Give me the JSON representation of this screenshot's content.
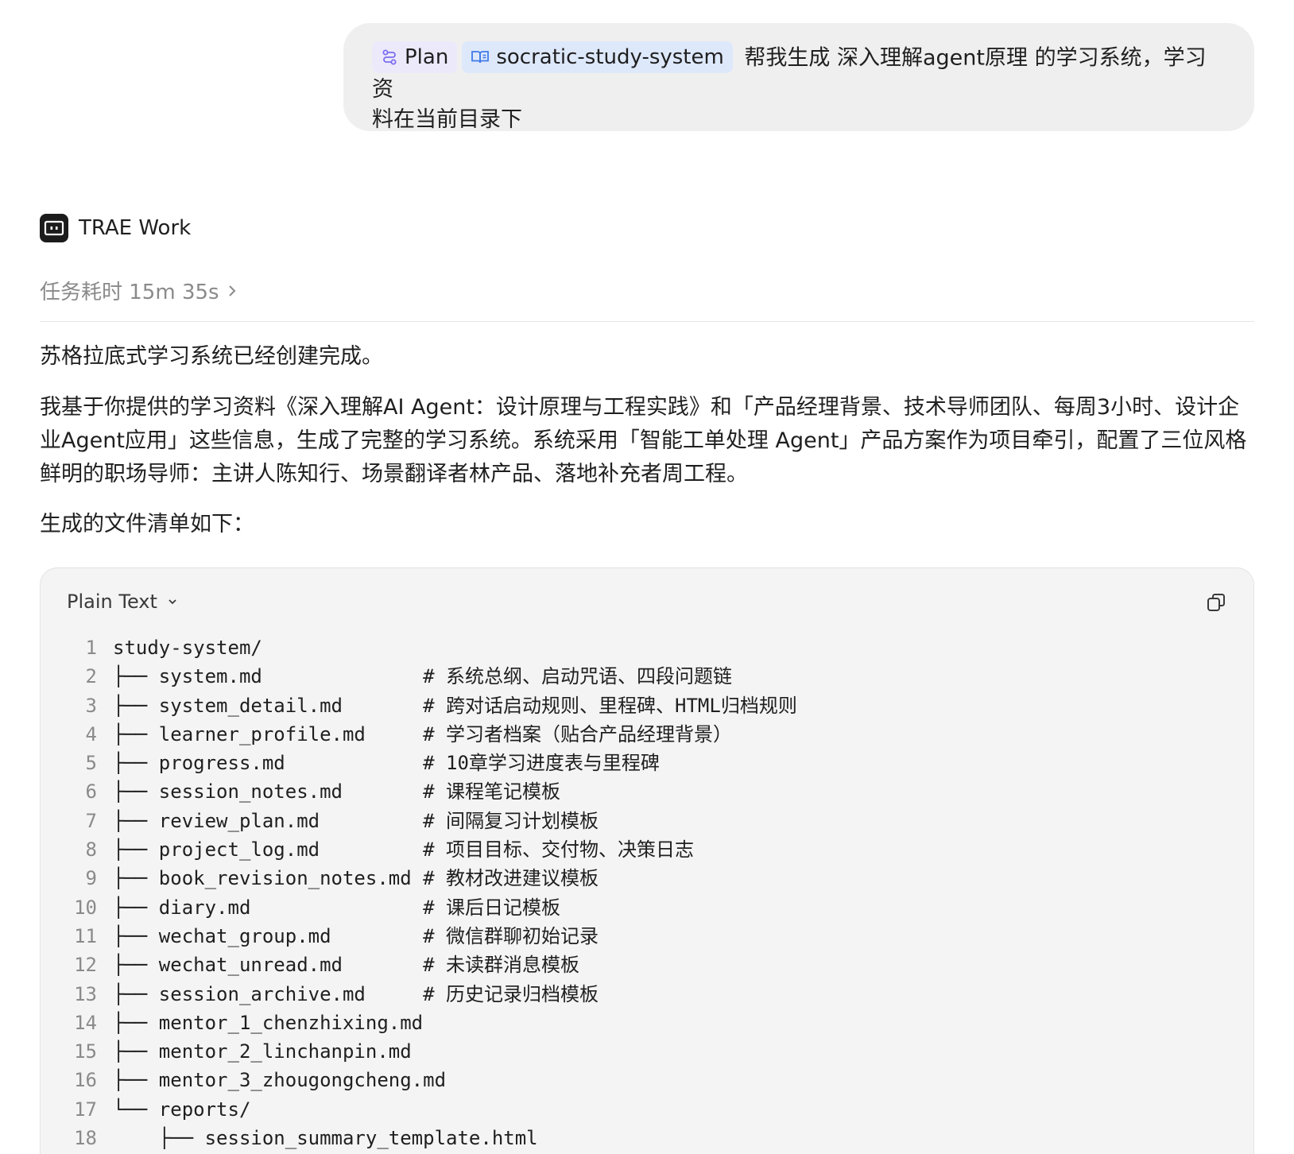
{
  "user_message": {
    "plan_chip": "Plan",
    "skill_chip": "socratic-study-system",
    "text_line1": " 帮我生成 深入理解agent原理 的学习系统，学习资",
    "text_line2": "料在当前目录下"
  },
  "agent": {
    "name": "TRAE Work",
    "task_time": "任务耗时 15m 35s"
  },
  "response": {
    "p1": "苏格拉底式学习系统已经创建完成。",
    "p2": "我基于你提供的学习资料《深入理解AI Agent：设计原理与工程实践》和「产品经理背景、技术导师团队、每周3小时、设计企业Agent应用」这些信息，生成了完整的学习系统。系统采用「智能工单处理 Agent」产品方案作为项目牵引，配置了三位风格鲜明的职场导师：主讲人陈知行、场景翻译者林产品、落地补充者周工程。",
    "p3": "生成的文件清单如下："
  },
  "code_block": {
    "language": "Plain Text",
    "lines": [
      "study-system/",
      "├── system.md              # 系统总纲、启动咒语、四段问题链",
      "├── system_detail.md       # 跨对话启动规则、里程碑、HTML归档规则",
      "├── learner_profile.md     # 学习者档案（贴合产品经理背景）",
      "├── progress.md            # 10章学习进度表与里程碑",
      "├── session_notes.md       # 课程笔记模板",
      "├── review_plan.md         # 间隔复习计划模板",
      "├── project_log.md         # 项目目标、交付物、决策日志",
      "├── book_revision_notes.md # 教材改进建议模板",
      "├── diary.md               # 课后日记模板",
      "├── wechat_group.md        # 微信群聊初始记录",
      "├── wechat_unread.md       # 未读群消息模板",
      "├── session_archive.md     # 历史记录归档模板",
      "├── mentor_1_chenzhixing.md",
      "├── mentor_2_linchanpin.md",
      "├── mentor_3_zhougongcheng.md",
      "└── reports/",
      "    ├── session_summary_template.html"
    ]
  },
  "colors": {
    "bubble_bg": "#efefef",
    "plan_chip_bg": "#ece9fb",
    "plan_icon": "#7b6cf0",
    "skill_chip_bg": "#dee8fb",
    "skill_icon": "#3f7be8",
    "muted_text": "#8a8a8a",
    "code_bg": "#f4f4f4"
  },
  "icons": {
    "plan": "plan-flow-icon",
    "skill": "book-skill-icon",
    "agent_logo": "trae-logo-icon",
    "task_time": "chevron-right-icon",
    "language": "chevron-down-icon",
    "copy": "copy-icon"
  }
}
